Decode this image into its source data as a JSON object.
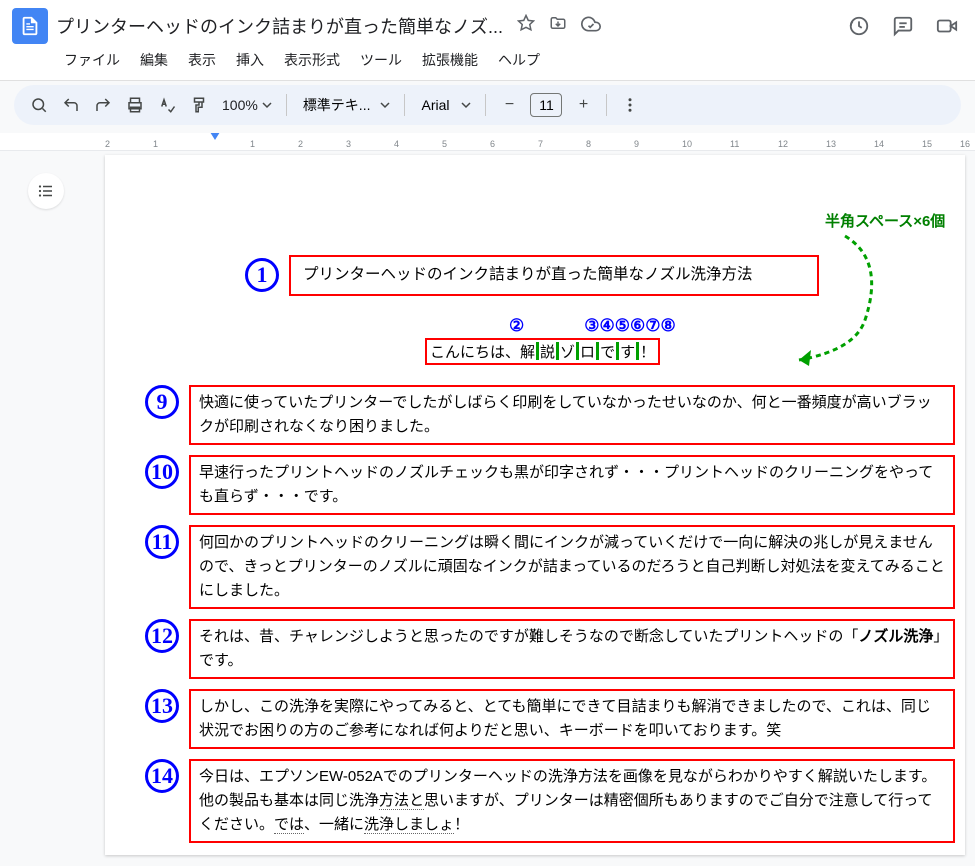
{
  "header": {
    "doc_title": "プリンターヘッドのインク詰まりが直った簡単なノズ...",
    "star_icon": "star",
    "move_icon": "folder-move",
    "cloud_icon": "cloud-done"
  },
  "menubar": {
    "file": "ファイル",
    "edit": "編集",
    "view": "表示",
    "insert": "挿入",
    "format": "表示形式",
    "tools": "ツール",
    "extensions": "拡張機能",
    "help": "ヘルプ"
  },
  "toolbar": {
    "zoom": "100%",
    "style": "標準テキ...",
    "font": "Arial",
    "size": "11"
  },
  "ruler": {
    "marks": [
      "2",
      "1",
      "",
      "1",
      "2",
      "3",
      "4",
      "5",
      "6",
      "7",
      "8",
      "9",
      "10",
      "11",
      "12",
      "13",
      "14",
      "15",
      "16"
    ]
  },
  "annotations": {
    "spaces_note": "半角スペース×6個",
    "num1": "1",
    "num9": "9",
    "num10": "10",
    "num11": "11",
    "num12": "12",
    "num13": "13",
    "num14": "14",
    "gn2": "②",
    "gn3": "③",
    "gn4": "④",
    "gn5": "⑤",
    "gn6": "⑥",
    "gn7": "⑦",
    "gn8": "⑧"
  },
  "content": {
    "title_box": "プリンターヘッドのインク詰まりが直った簡単なノズル洗浄方法",
    "greeting_pre": "こんにちは、解",
    "greeting_c1": "説",
    "greeting_c2": "ゾ",
    "greeting_c3": "ロ",
    "greeting_c4": "で",
    "greeting_c5": "す",
    "greeting_c6": "！",
    "p9": "快適に使っていたプリンターでしたがしばらく印刷をしていなかったせいなのか、何と一番頻度が高いブラックが印刷されなくなり困りました。",
    "p10": "早速行ったプリントヘッドのノズルチェックも黒が印字されず・・・プリントヘッドのクリーニングをやっても直らず・・・です。",
    "p11": "何回かのプリントヘッドのクリーニングは瞬く間にインクが減っていくだけで一向に解決の兆しが見えませんので、きっとプリンターのノズルに頑固なインクが詰まっているのだろうと自己判断し対処法を変えてみることにしました。",
    "p12_a": "それは、昔、チャレンジしようと思ったのですが難しそうなので断念していたプリントヘッドの「",
    "p12_b": "ノズル洗浄",
    "p12_c": "」です。",
    "p13": "しかし、この洗浄を実際にやってみると、とても簡単にできて目詰まりも解消できましたので、これは、同じ状況でお困りの方のご参考になれば何よりだと思い、キーボードを叩いております。笑",
    "p14_a": "今日は、エプソンEW-052Aでのプリンターヘッドの洗浄方法を画像を見ながらわかりやすく解説いたします。他の製品も基本は同じ洗浄",
    "p14_b": "方法と",
    "p14_c": "思いますが、プリンターは精密個所もありますのでご自分で注意して行ってください。",
    "p14_d": "では",
    "p14_e": "、一緒に",
    "p14_f": "洗浄しましょ",
    "p14_g": "！"
  }
}
